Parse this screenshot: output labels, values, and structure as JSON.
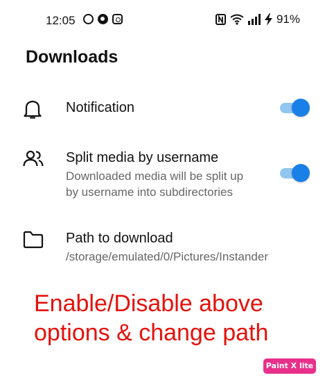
{
  "status_bar": {
    "time": "12:05",
    "app_icons": [
      "whatsapp-icon",
      "app-icon",
      "instagram-icon"
    ],
    "system_icons": [
      "nfc-icon",
      "wifi-icon",
      "signal-icon",
      "charging-icon"
    ],
    "battery": "91%"
  },
  "page": {
    "title": "Downloads"
  },
  "settings": [
    {
      "icon": "bell-icon",
      "title": "Notification",
      "subtitle": "",
      "toggle_on": true
    },
    {
      "icon": "users-icon",
      "title": "Split media by username",
      "subtitle_line1": "Downloaded media will be split up",
      "subtitle_line2": "by username into subdirectories",
      "toggle_on": true
    },
    {
      "icon": "folder-icon",
      "title": "Path to download",
      "subtitle": "/storage/emulated/0/Pictures/Instander"
    }
  ],
  "annotation": {
    "line1": "Enable/Disable above",
    "line2": "options & change path"
  },
  "watermark": {
    "text": "Paint X lite"
  },
  "colors": {
    "accent": "#1a80e8",
    "track": "#90c6ef",
    "annotation": "#e3120b",
    "watermark": "#e8308a"
  }
}
